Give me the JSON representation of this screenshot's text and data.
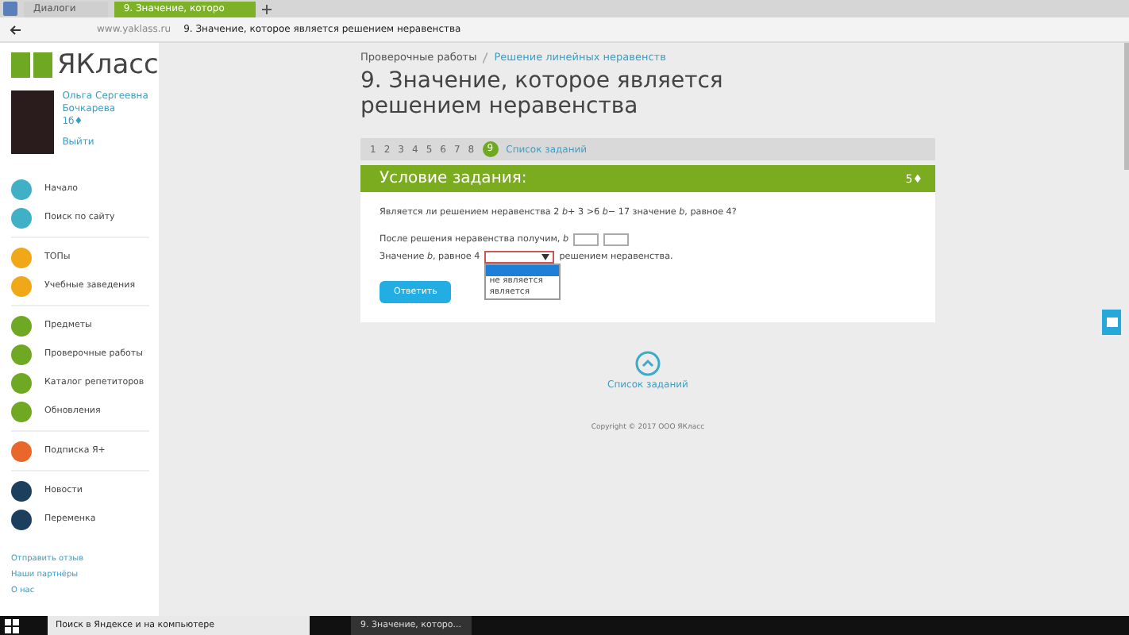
{
  "browser": {
    "tabs": [
      {
        "label": "Диалоги",
        "selected": false
      },
      {
        "label": "9. Значение, которо",
        "selected": true
      }
    ],
    "address": {
      "host": "www.yaklass.ru",
      "title": "9. Значение, которое является решением неравенства"
    }
  },
  "sidebar": {
    "logo": "ЯКласс",
    "user": {
      "name": "Ольга Сергеевна Бочкарева",
      "balance": "1б♦",
      "logout": "Выйти"
    },
    "groups": [
      [
        {
          "label": "Начало",
          "color": "#3fb0c6"
        },
        {
          "label": "Поиск по сайту",
          "color": "#3fb0c6"
        }
      ],
      [
        {
          "label": "ТОПы",
          "color": "#f0a818"
        },
        {
          "label": "Учебные заведения",
          "color": "#f0a818"
        }
      ],
      [
        {
          "label": "Предметы",
          "color": "#6fa822"
        },
        {
          "label": "Проверочные работы",
          "color": "#6fa822"
        },
        {
          "label": "Каталог репетиторов",
          "color": "#6fa822"
        },
        {
          "label": "Обновления",
          "color": "#6fa822"
        }
      ],
      [
        {
          "label": "Подписка Я+",
          "color": "#e8672a"
        }
      ],
      [
        {
          "label": "Новости",
          "color": "#1d3f5e"
        },
        {
          "label": "Переменка",
          "color": "#1d3f5e"
        }
      ]
    ],
    "footer_links": [
      "Отправить отзыв",
      "Наши партнёры",
      "О нас"
    ]
  },
  "breadcrumbs": [
    "Проверочные работы",
    "Решение линейных неравенств"
  ],
  "title": "9. Значение, которое является решением неравенства",
  "pager": {
    "pages": [
      {
        "label": "1",
        "selected": false
      },
      {
        "label": "2",
        "selected": false
      },
      {
        "label": "3",
        "selected": false
      },
      {
        "label": "4",
        "selected": false
      },
      {
        "label": "5",
        "selected": false
      },
      {
        "label": "6",
        "selected": false
      },
      {
        "label": "7",
        "selected": false
      },
      {
        "label": "8",
        "selected": false
      },
      {
        "label": "9",
        "selected": true
      }
    ],
    "list_link": "Список заданий"
  },
  "task": {
    "header": "Условие задания:",
    "points": "5♦",
    "question": "Является ли решением неравенства 2 *b*+ 3 >6 *b*− 17 значение *b*, равное 4?",
    "line1": "После решения неравенства получим, *b*",
    "line2_before": "Значение *b*, равное 4",
    "line2_after": "решением неравенства.",
    "dropdown": {
      "options": [
        {
          "selected": true
        },
        {
          "label": "не является",
          "selected": false
        },
        {
          "label": "является",
          "selected": false
        }
      ]
    },
    "submit": "Ответить"
  },
  "bottom_link": "Список заданий",
  "copyright": "Copyright © 2017 ООО ЯКласс",
  "taskbar": {
    "search": "Поиск в Яндексе и на компьютере",
    "window": "9. Значение, которо..."
  }
}
